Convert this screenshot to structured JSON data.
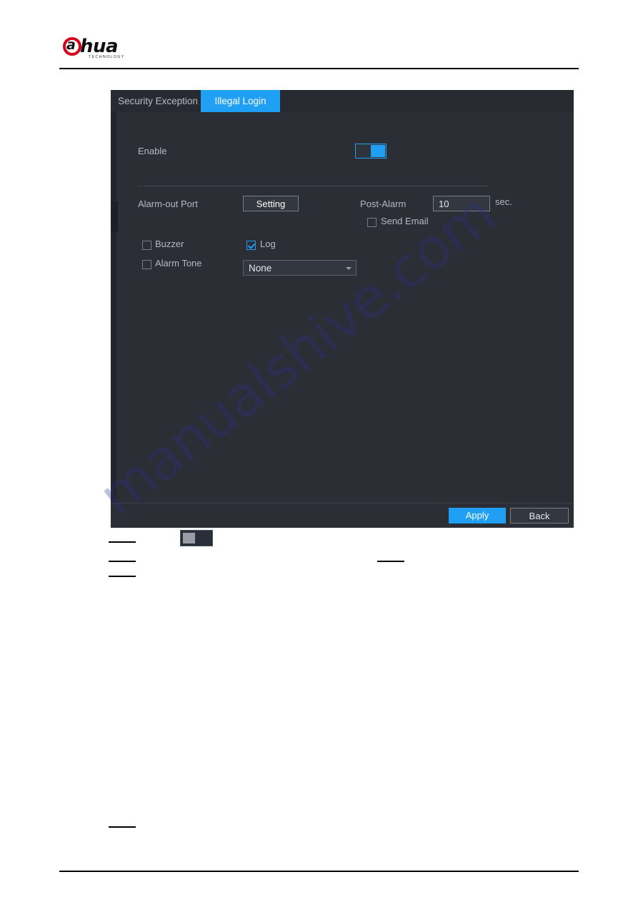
{
  "page": {
    "brand": {
      "name": "alhua",
      "letter": "a",
      "word": "hua",
      "tagline": "TECHNOLOGY"
    },
    "watermark": "manualshive.com"
  },
  "dialog": {
    "tabs": [
      {
        "label": "Security Exception",
        "active": false
      },
      {
        "label": "Illegal Login",
        "active": true
      }
    ],
    "fields": {
      "enable": {
        "label": "Enable",
        "state": "on"
      },
      "alarm_out_port": {
        "label": "Alarm-out Port",
        "button": "Setting"
      },
      "post_alarm": {
        "label": "Post-Alarm",
        "value": "10",
        "unit": "sec."
      },
      "send_email": {
        "label": "Send Email",
        "checked": false
      },
      "buzzer": {
        "label": "Buzzer",
        "checked": false
      },
      "log": {
        "label": "Log",
        "checked": true
      },
      "alarm_tone": {
        "label": "Alarm Tone",
        "checked": false
      },
      "alarm_tone_select": {
        "value": "None"
      }
    },
    "footer": {
      "apply": "Apply",
      "back": "Back"
    }
  },
  "colors": {
    "accent": "#1fa0f5",
    "dialog_bg": "#2b2e35",
    "tabbar_bg": "#272a31",
    "brand_red": "#d6001c",
    "watermark": "#2b2f8a"
  }
}
